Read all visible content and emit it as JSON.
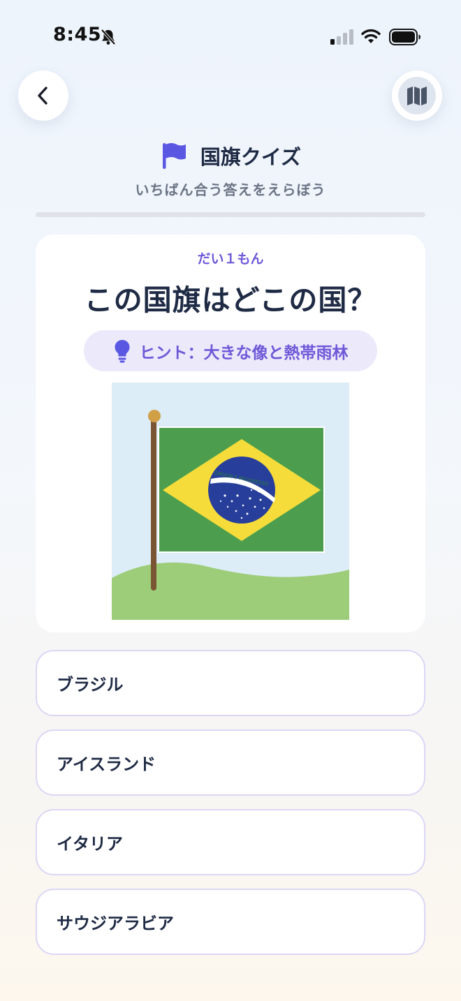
{
  "status_bar": {
    "time": "8:45"
  },
  "header": {
    "title": "国旗クイズ",
    "subtitle": "いちばん合う答えをえらぼう",
    "back_icon": "chevron-left-icon",
    "map_icon": "map-icon",
    "title_icon": "flag-icon"
  },
  "progress": {
    "value": 0
  },
  "question": {
    "number_label": "だい１もん",
    "text": "この国旗はどこの国？",
    "hint": "ヒント：大きな像と熱帯雨林",
    "hint_icon": "lightbulb-icon",
    "flag_banner_text": "ORDEM E PROGRESSO"
  },
  "options": [
    {
      "label": "ブラジル"
    },
    {
      "label": "アイスランド"
    },
    {
      "label": "イタリア"
    },
    {
      "label": "サウジアラビア"
    }
  ],
  "colors": {
    "accent": "#6f58d8",
    "text_dark": "#1f2b45",
    "option_border": "#dcd6f6",
    "hint_bg": "#ece9fb",
    "flag_green": "#4c9e4e",
    "flag_yellow": "#f5dc3b",
    "flag_blue": "#283e9b"
  }
}
